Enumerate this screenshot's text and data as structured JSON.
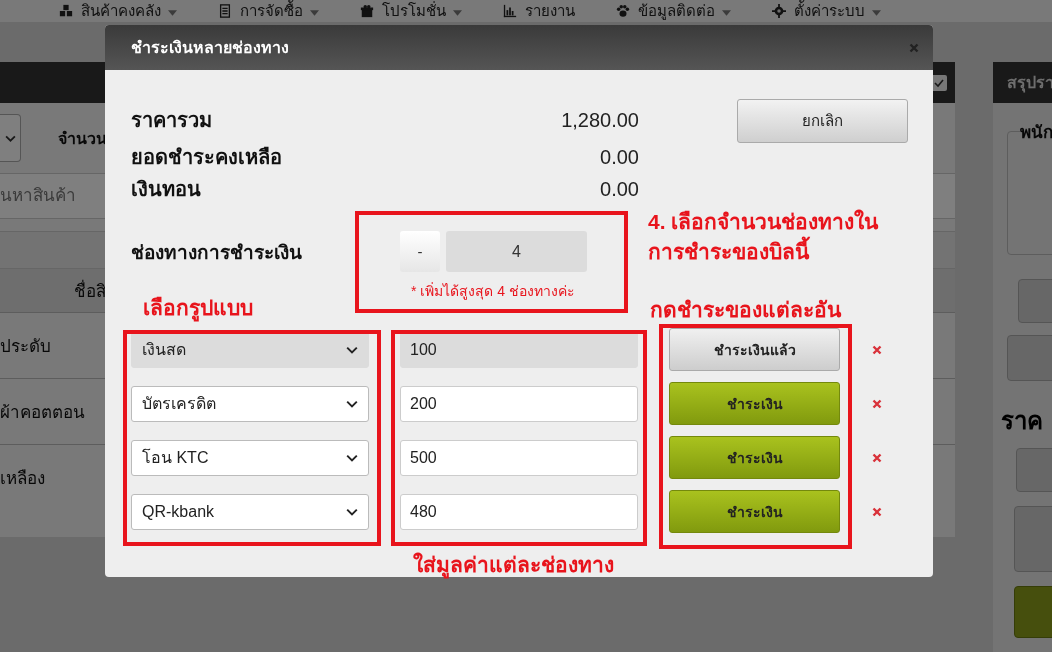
{
  "nav": [
    {
      "label": "สินค้าคงคลัง",
      "kind": "cubes",
      "dropdown": true
    },
    {
      "label": "การจัดซื้อ",
      "kind": "document",
      "dropdown": true
    },
    {
      "label": "โปรโมชั่น",
      "kind": "gift",
      "dropdown": true
    },
    {
      "label": "รายงาน",
      "kind": "chart",
      "dropdown": false
    },
    {
      "label": "ข้อมูลติดต่อ",
      "kind": "paw",
      "dropdown": true
    },
    {
      "label": "ตั้งค่าระบบ",
      "kind": "gear",
      "dropdown": true
    }
  ],
  "order_panel": {
    "header_checkbox": {
      "checked": true
    },
    "quantity_label": "จำนวน",
    "search": {
      "placeholder": "นหาสินค้า"
    },
    "table": {
      "columns": [
        "ชื่อสิ"
      ],
      "rows": [
        "ประดับ",
        "ผ้าคอตตอน",
        "เหลือง"
      ]
    }
  },
  "summary_panel": {
    "title": "สรุปรา",
    "staff_legend": "พนัก",
    "price_heading": "ราค"
  },
  "modal": {
    "title": "ชำระเงินหลายช่องทาง",
    "summary": [
      {
        "label": "ราคารวม",
        "value": "1,280.00"
      },
      {
        "label": "ยอดชำระคงเหลือ",
        "value": "0.00"
      },
      {
        "label": "เงินทอน",
        "value": "0.00"
      }
    ],
    "cancel_button": "ยกเลิก",
    "channels": {
      "label": "ช่องทางการชำระเงิน",
      "decrement": "-",
      "count": "4",
      "note": "* เพิ่มได้สูงสุด 4 ช่องทางค่ะ"
    },
    "payments": [
      {
        "method": "เงินสด",
        "amount": "100",
        "paid": true,
        "button": "ชำระเงินแล้ว"
      },
      {
        "method": "บัตรเครดิต",
        "amount": "200",
        "paid": false,
        "button": "ชำระเงิน"
      },
      {
        "method": "โอน KTC",
        "amount": "500",
        "paid": false,
        "button": "ชำระเงิน"
      },
      {
        "method": "QR-kbank",
        "amount": "480",
        "paid": false,
        "button": "ชำระเงิน"
      }
    ]
  },
  "annotations": {
    "count_note": [
      "4. เลือกจำนวนช่องทางใน",
      "การชำระของบิลนี้"
    ],
    "method_note": "เลือกรูปแบบ",
    "pay_note": "กดชำระของแต่ละอัน",
    "amount_note": "ใส่มูลค่าแต่ละช่องทาง"
  }
}
